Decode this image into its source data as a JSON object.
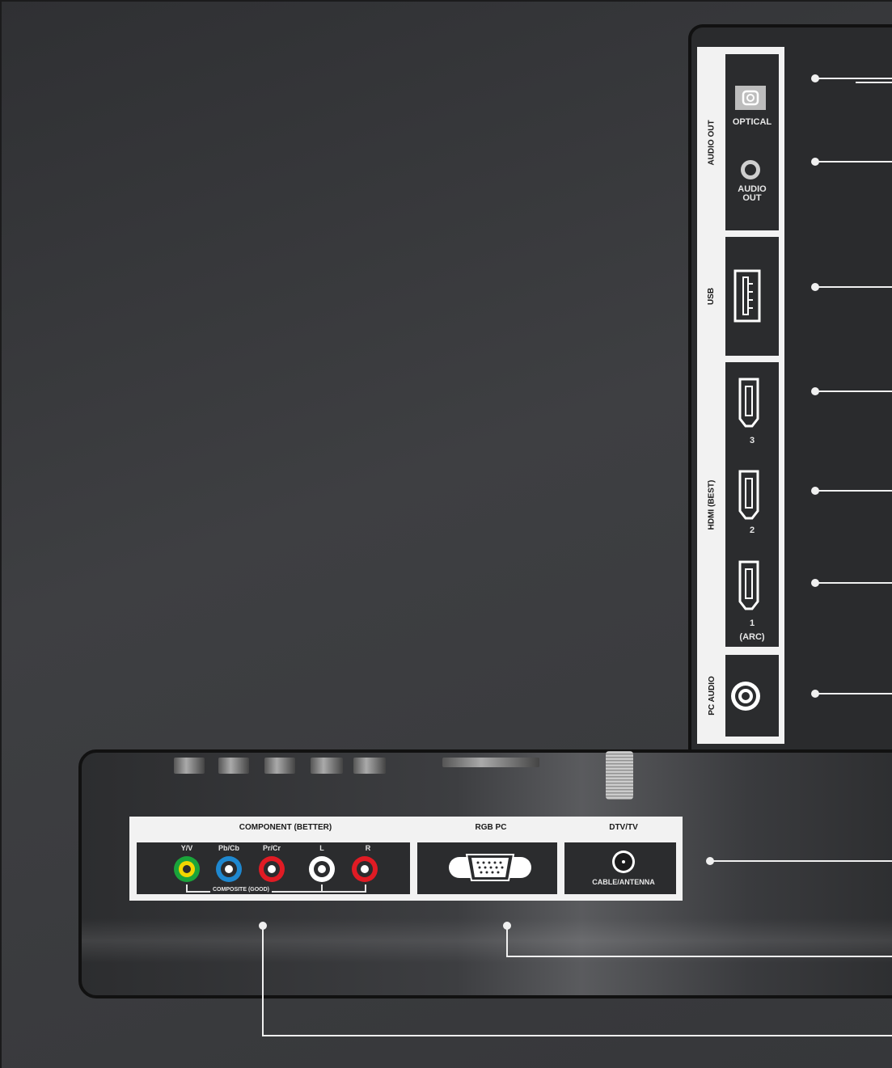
{
  "side_panel": {
    "audio_out_group_label": "AUDIO OUT",
    "optical_label": "OPTICAL",
    "audio_out_label_line1": "AUDIO",
    "audio_out_label_line2": "OUT",
    "usb_group_label": "USB",
    "hdmi_group_label": "HDMI (BEST)",
    "hdmi3_label": "3",
    "hdmi2_label": "2",
    "hdmi1_label": "1",
    "hdmi1_arc_label": "(ARC)",
    "pc_audio_group_label": "PC AUDIO"
  },
  "bottom_panel": {
    "component_header": "COMPONENT (BETTER)",
    "rgb_header": "RGB PC",
    "dtv_header": "DTV/TV",
    "jacks": [
      {
        "label": "Y/V",
        "color": "#1aa43a"
      },
      {
        "label": "Pb/Cb",
        "color": "#1e88d0"
      },
      {
        "label": "Pr/Cr",
        "color": "#e01b24"
      },
      {
        "label": "L",
        "color": "#ffffff"
      },
      {
        "label": "R",
        "color": "#e01b24"
      }
    ],
    "composite_label": "COMPOSITE (GOOD)",
    "antenna_label": "CABLE/ANTENNA"
  },
  "colors": {
    "panel_dark": "#2b2c2e",
    "frame_white": "#f2f2f2",
    "callout_line": "#f0f0f0"
  }
}
